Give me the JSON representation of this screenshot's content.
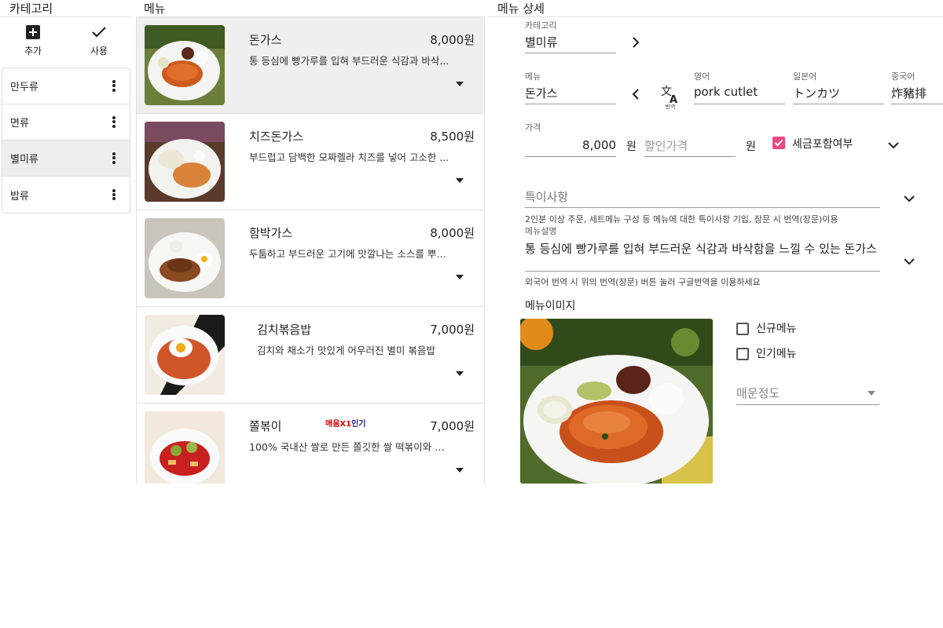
{
  "headers": {
    "category": "카테고리",
    "menu": "메뉴",
    "detail": "메뉴 상세"
  },
  "category_panel": {
    "add_label": "추가",
    "use_label": "사용",
    "items": [
      {
        "label": "만두류"
      },
      {
        "label": "면류"
      },
      {
        "label": "별미류",
        "selected": true
      },
      {
        "label": "밥류"
      }
    ]
  },
  "menu_list": [
    {
      "name": "돈가스",
      "price": "8,000원",
      "desc": "통 등심에 빵가루를 입혀 부드러운 식감과 바삭...",
      "selected": true
    },
    {
      "name": "치즈돈가스",
      "price": "8,500원",
      "desc": "부드럽고 담백한 모짜렐라 치즈를 넣어 고소한 ..."
    },
    {
      "name": "함박가스",
      "price": "8,000원",
      "desc": "두툼하고 부드러운 고기에 맛깔나는 소스를 뿌린..."
    },
    {
      "name": "김치볶음밥",
      "price": "7,000원",
      "desc": "김치와 채소가 맛있게 어우러진 별미 볶음밥"
    },
    {
      "name": "쫄볶이",
      "price": "7,000원",
      "desc": "100% 국내산 쌀로 만든 쫄깃한 쌀 떡볶이와 쫄...",
      "tag_spicy": "매움X1",
      "tag_popular": "인기"
    }
  ],
  "detail": {
    "category_label": "카테고리",
    "category_value": "별미류",
    "menu_label": "메뉴",
    "menu_value": "돈가스",
    "translate_icon_text": "번역",
    "english_label": "영어",
    "english_value": "pork cutlet",
    "japanese_label": "일본어",
    "japanese_value": "トンカツ",
    "chinese_label": "중국어",
    "chinese_value": "炸豬排",
    "price_label": "가격",
    "price_value": "8,000",
    "price_unit": "원",
    "discount_placeholder": "할인가격",
    "discount_unit": "원",
    "tax_label": "세금포함여부",
    "tax_checked": true,
    "special_placeholder": "특이사항",
    "special_helper": "2인분 이상 주문, 세트메뉴 구성 등 메뉴에 대한 특이사항 기입, 장문 시 번역(장문)이용",
    "desc_label": "메뉴설명",
    "desc_value": "통 등심에 빵가루를 입혀 부드러운 식감과 바삭함을 느낄 수 있는 돈가스",
    "desc_helper": "외국어 번역 시 위의 번역(장문) 버튼 눌러 구글번역을 이용하세요",
    "image_label": "메뉴이미지",
    "new_menu_label": "신규메뉴",
    "new_menu_checked": false,
    "popular_menu_label": "인기메뉴",
    "popular_menu_checked": false,
    "spicy_placeholder": "매운정도"
  },
  "colors": {
    "accent": "#e84a83",
    "selected_bg": "#eeeeee"
  }
}
